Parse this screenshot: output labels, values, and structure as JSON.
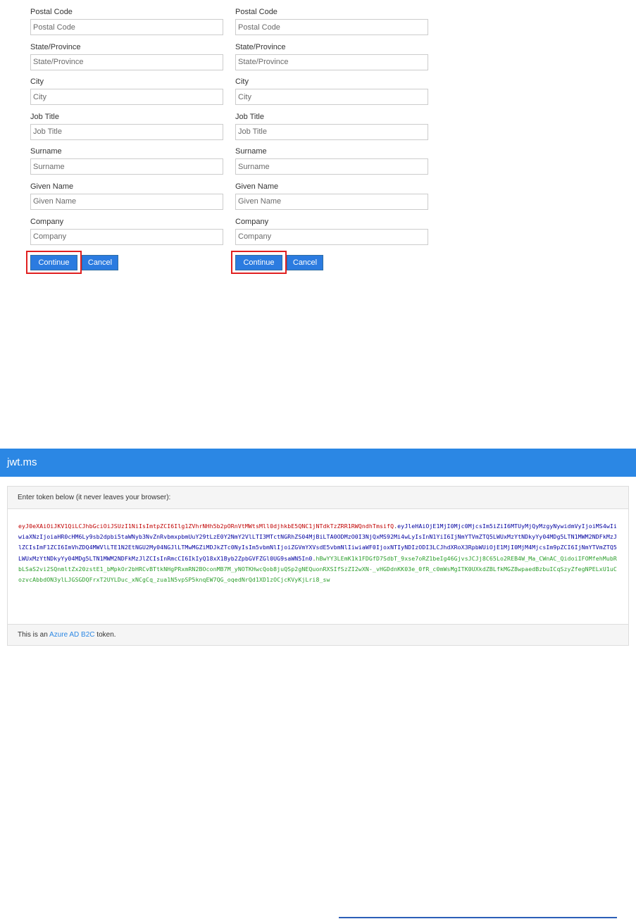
{
  "form_left": {
    "fields": [
      {
        "label": "Postal Code",
        "placeholder": "Postal Code"
      },
      {
        "label": "State/Province",
        "placeholder": "State/Province"
      },
      {
        "label": "City",
        "placeholder": "City"
      },
      {
        "label": "Job Title",
        "placeholder": "Job Title"
      },
      {
        "label": "Surname",
        "placeholder": "Surname"
      },
      {
        "label": "Given Name",
        "placeholder": "Given Name"
      },
      {
        "label": "Company",
        "placeholder": "Company"
      }
    ],
    "continue_label": "Continue",
    "cancel_label": "Cancel"
  },
  "form_right": {
    "fields": [
      {
        "label": "Postal Code",
        "placeholder": "Postal Code"
      },
      {
        "label": "State/Province",
        "placeholder": "State/Province"
      },
      {
        "label": "City",
        "placeholder": "City"
      },
      {
        "label": "Job Title",
        "placeholder": "Job Title"
      },
      {
        "label": "Surname",
        "placeholder": "Surname"
      },
      {
        "label": "Given Name",
        "placeholder": "Given Name"
      },
      {
        "label": "Company",
        "placeholder": "Company"
      }
    ],
    "continue_label": "Continue",
    "cancel_label": "Cancel"
  },
  "jwt": {
    "app_title": "jwt.ms",
    "prompt": "Enter token below (it never leaves your browser):",
    "token": {
      "header": "eyJ0eXAiOiJKV1QiLCJhbGciOiJSUzI1NiIsImtpZCI6Ilg1ZVhrNHh5b2pORnVtMWtsMll0djhkbE5QNC1jNTdkTzZRR1RWQndhTmsifQ",
      "payload": "eyJleHAiOjE1MjI0Mjc0MjcsIm5iZiI6MTUyMjQyMzgyNywidmVyIjoiMS4wIiwiaXNzIjoiaHR0cHM6Ly9sb2dpbi5taWNyb3NvZnRvbmxpbmUuY29tLzE0Y2NmY2VlLTI3MTctNGRhZS04MjBiLTA0ODMzO0I3NjQxMS92Mi4wLyIsInN1YiI6IjNmYTVmZTQ5LWUxMzYtNDkyYy04MDg5LTN1MWM2NDFkMzJlZCIsImF1ZCI6ImVhZDQ4MWVlLTE1N2EtNGU2My04NGJlLTMwMGZiMDJkZTc0NyIsIm5vbmNlIjoiZGVmYXVsdE5vbmNlIiwiaWF0IjoxNTIyNDIzODI3LCJhdXRoX3RpbWUiOjE1MjI0MjM4MjcsIm9pZCI6IjNmYTVmZTQ5LWUxMzYtNDkyYy04MDg5LTN1MWM2NDFkMzJlZCIsInRmcCI6IkIyQ18xX1Byb2ZpbGVFZGl0UG9saWN5In0",
      "signature": "hBwYY3LEmK1k1FDGfD7SdbT_9xse7oRZ1beIg46GjvsJCJj8C65Lo2REB4W_Ma_CWnAC_QidoiIFOMfehMubRbLSaS2vi2SQnmltZx20zstE1_bMpkOr2bHRCvBTtkNHgPRxmRN2BOconMB7M_yNOTKHwcQob8juQSp2gNEQuonRXSIfSzZI2wXN-_vHGDdnKK03e_0fR_c0mWsMgITK0UXkdZBLfkMGZ8wpaedBzbuICqSzyZfegNPELxU1uCozvcAbbdON3ylLJGSGDQFrxT2UYLDuc_xNCgCq_zua1N5vpSP5knqEW7QG_oqedNrQd1XD1zOCjcKVyKjLri8_sw"
    },
    "footer_prefix": "This is an ",
    "footer_link": "Azure AD B2C",
    "footer_suffix": " token."
  },
  "colors": {
    "primary": "#2b7be0",
    "header_bar": "#2b87e4",
    "highlight": "#e02020",
    "token_header": "#c00000",
    "token_payload": "#0000a0",
    "token_signature": "#2a9d2a"
  }
}
